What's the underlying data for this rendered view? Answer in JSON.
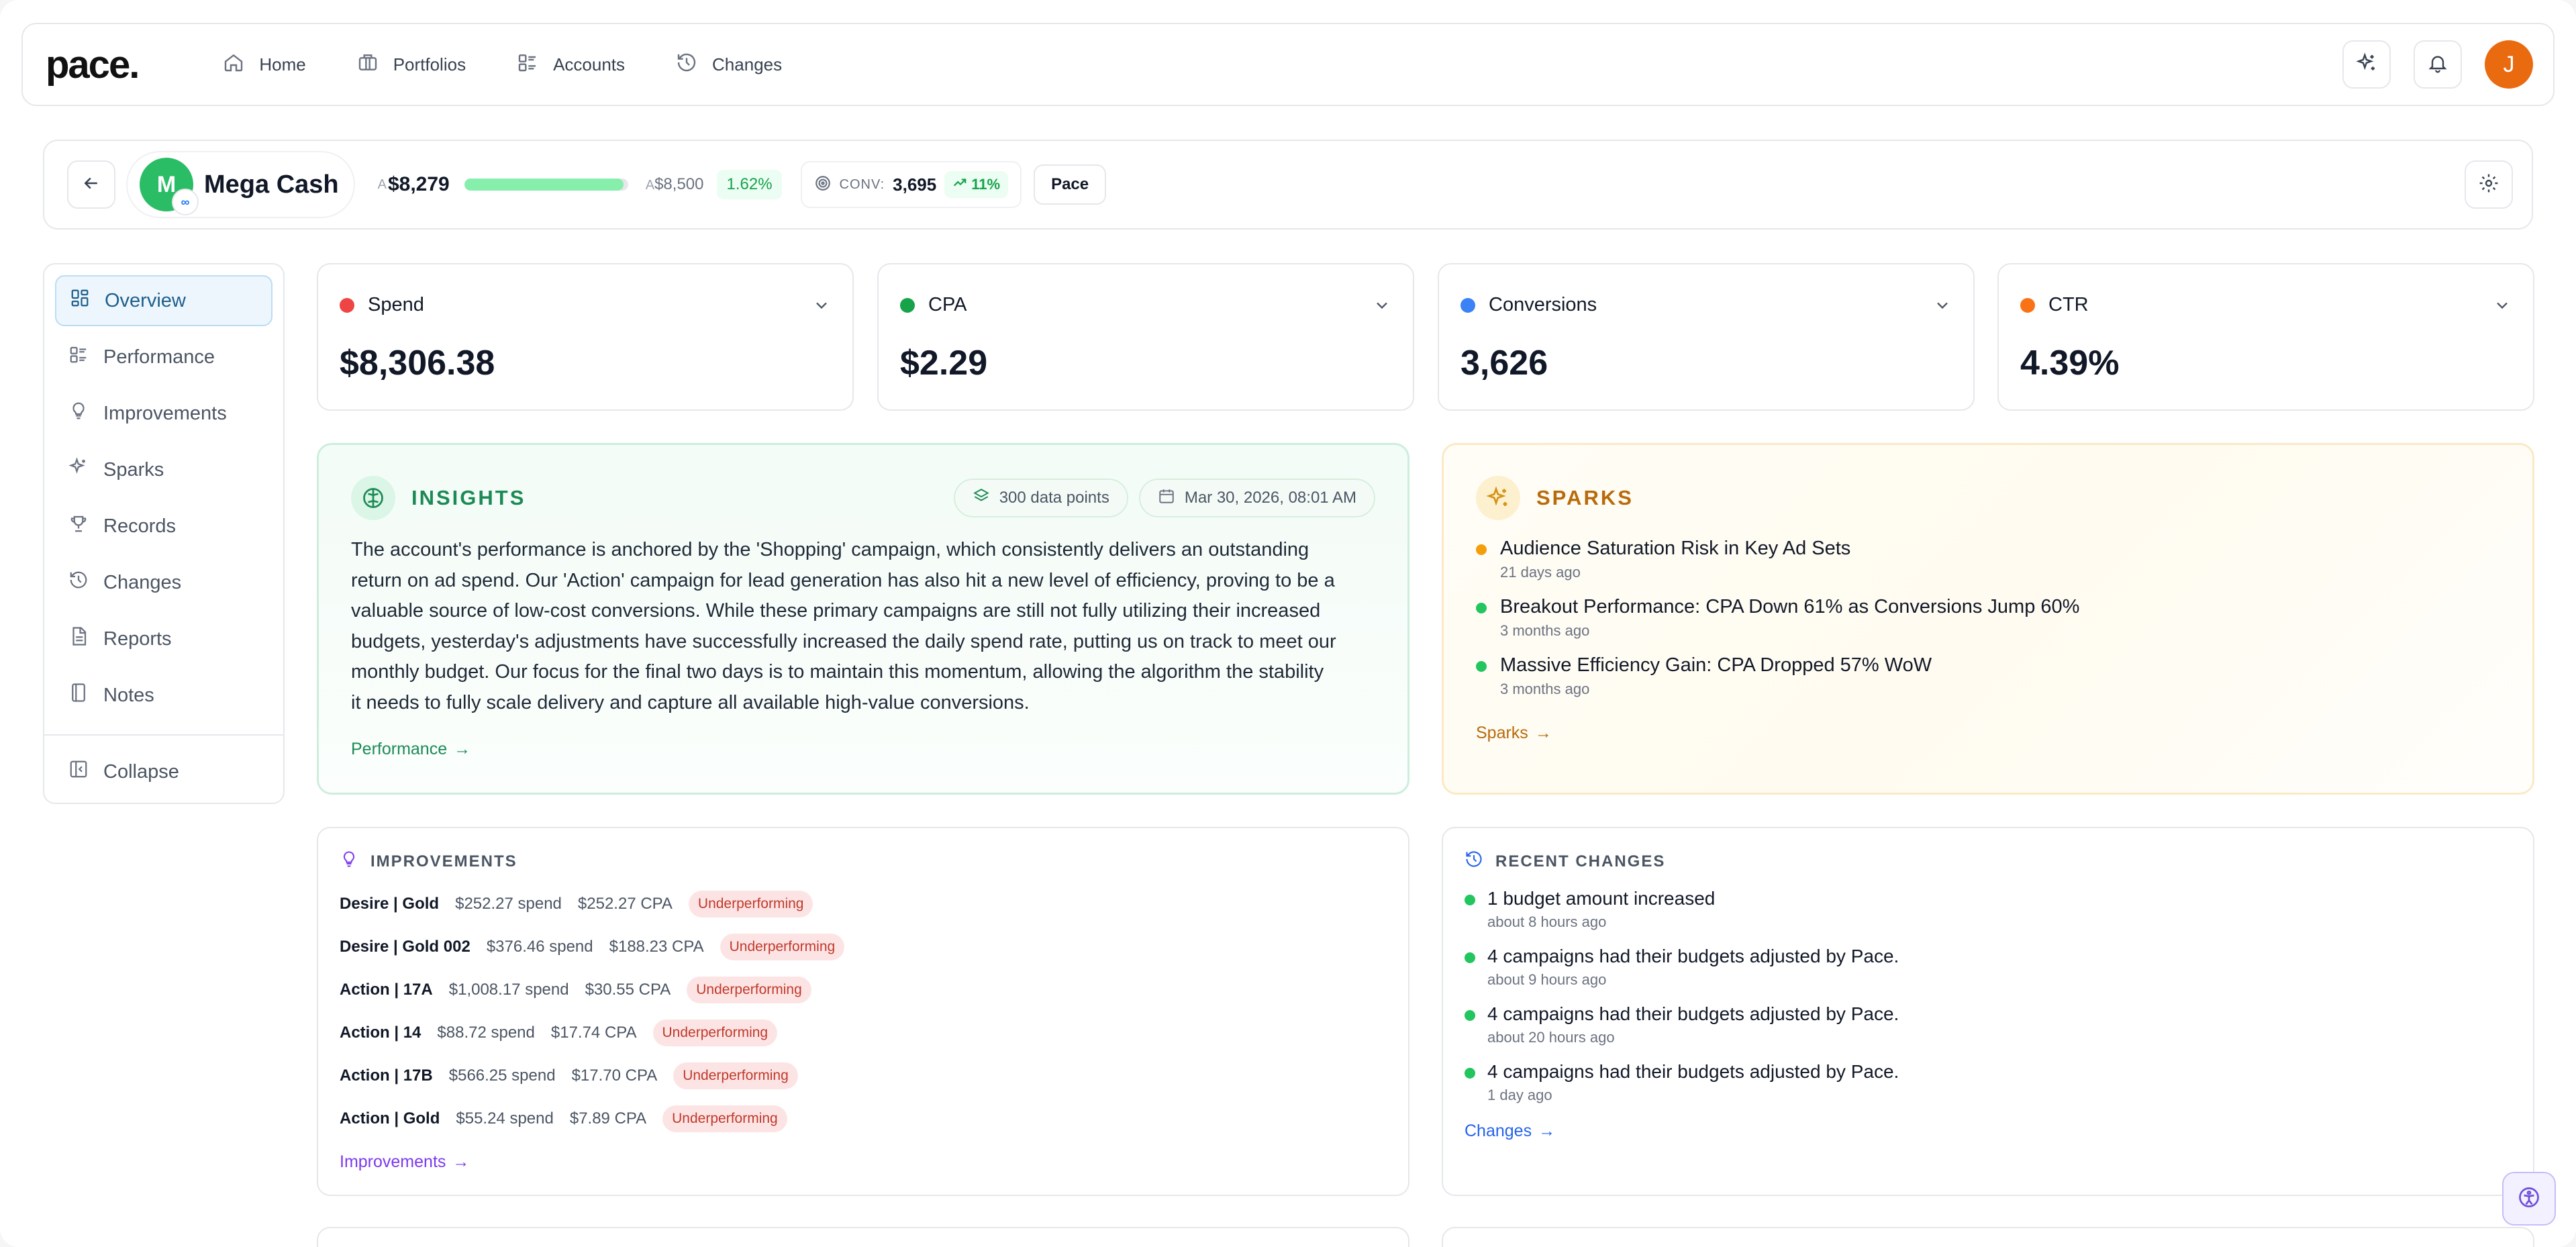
{
  "brand": {
    "logo": "pace."
  },
  "nav": {
    "items": [
      {
        "label": "Home",
        "icon": "home-icon"
      },
      {
        "label": "Portfolios",
        "icon": "briefcase-icon"
      },
      {
        "label": "Accounts",
        "icon": "accounts-list-icon"
      },
      {
        "label": "Changes",
        "icon": "history-icon"
      }
    ],
    "avatar_initial": "J"
  },
  "account": {
    "avatar_initial": "M",
    "name": "Mega Cash",
    "currency_symbol": "A",
    "spend": "$8,279",
    "budget": "$8,500",
    "spend_progress": 0.974,
    "pct": "1.62%",
    "conv_label": "CONV:",
    "conv_value": "3,695",
    "conv_trend": "11%",
    "pace_label": "Pace"
  },
  "sidebar": {
    "items": [
      {
        "label": "Overview",
        "icon": "overview-icon",
        "active": true
      },
      {
        "label": "Performance",
        "icon": "performance-icon"
      },
      {
        "label": "Improvements",
        "icon": "lightbulb-icon"
      },
      {
        "label": "Sparks",
        "icon": "sparkle-icon"
      },
      {
        "label": "Records",
        "icon": "trophy-icon"
      },
      {
        "label": "Changes",
        "icon": "history-icon"
      },
      {
        "label": "Reports",
        "icon": "report-icon"
      },
      {
        "label": "Notes",
        "icon": "notebook-icon"
      }
    ],
    "collapse_label": "Collapse"
  },
  "kpis": [
    {
      "label": "Spend",
      "value": "$8,306.38",
      "color": "#ef4444"
    },
    {
      "label": "CPA",
      "value": "$2.29",
      "color": "#16a34a"
    },
    {
      "label": "Conversions",
      "value": "3,626",
      "color": "#3b82f6"
    },
    {
      "label": "CTR",
      "value": "4.39%",
      "color": "#f97316"
    }
  ],
  "insights": {
    "title": "INSIGHTS",
    "data_points": "300 data points",
    "date": "Mar 30, 2026, 08:01 AM",
    "lines": [
      "The account's performance is anchored by the 'Shopping' campaign, which consistently delivers an outstanding",
      "return on ad spend. Our 'Action' campaign for lead generation has also hit a new level of efficiency, proving to be a",
      "valuable source of low-cost conversions. While these primary campaigns are still not fully utilizing their increased",
      "budgets, yesterday's adjustments have successfully increased the daily spend rate, putting us on track to meet our",
      "monthly budget. Our focus for the final two days is to maintain this momentum, allowing the algorithm the stability",
      "it needs to fully scale delivery and capture all available high-value conversions."
    ],
    "link": "Performance",
    "accent": "#1c8a55"
  },
  "sparks": {
    "title": "SPARKS",
    "items": [
      {
        "title": "Audience Saturation Risk in Key Ad Sets",
        "time": "21 days ago",
        "color": "#f59e0b"
      },
      {
        "title": "Breakout Performance: CPA Down 61% as Conversions Jump 60%",
        "time": "3 months ago",
        "color": "#22c55e"
      },
      {
        "title": "Massive Efficiency Gain: CPA Dropped 57% WoW",
        "time": "3 months ago",
        "color": "#22c55e"
      }
    ],
    "link": "Sparks",
    "accent": "#b86b0a"
  },
  "improvements": {
    "title": "IMPROVEMENTS",
    "rows": [
      {
        "name": "Desire | Gold",
        "spend": "$252.27 spend",
        "cpa": "$252.27 CPA",
        "badge": "Underperforming"
      },
      {
        "name": "Desire | Gold 002",
        "spend": "$376.46 spend",
        "cpa": "$188.23 CPA",
        "badge": "Underperforming"
      },
      {
        "name": "Action | 17A",
        "spend": "$1,008.17 spend",
        "cpa": "$30.55 CPA",
        "badge": "Underperforming"
      },
      {
        "name": "Action | 14",
        "spend": "$88.72 spend",
        "cpa": "$17.74 CPA",
        "badge": "Underperforming"
      },
      {
        "name": "Action | 17B",
        "spend": "$566.25 spend",
        "cpa": "$17.70 CPA",
        "badge": "Underperforming"
      },
      {
        "name": "Action | Gold",
        "spend": "$55.24 spend",
        "cpa": "$7.89 CPA",
        "badge": "Underperforming"
      }
    ],
    "link": "Improvements",
    "accent": "#7c3aed"
  },
  "recent_changes": {
    "title": "RECENT CHANGES",
    "items": [
      {
        "title": "1 budget amount increased",
        "time": "about 8 hours ago"
      },
      {
        "title": "4 campaigns had their budgets adjusted by Pace.",
        "time": "about 9 hours ago"
      },
      {
        "title": "4 campaigns had their budgets adjusted by Pace.",
        "time": "about 20 hours ago"
      },
      {
        "title": "4 campaigns had their budgets adjusted by Pace.",
        "time": "1 day ago"
      }
    ],
    "link": "Changes",
    "accent": "#2563eb"
  }
}
